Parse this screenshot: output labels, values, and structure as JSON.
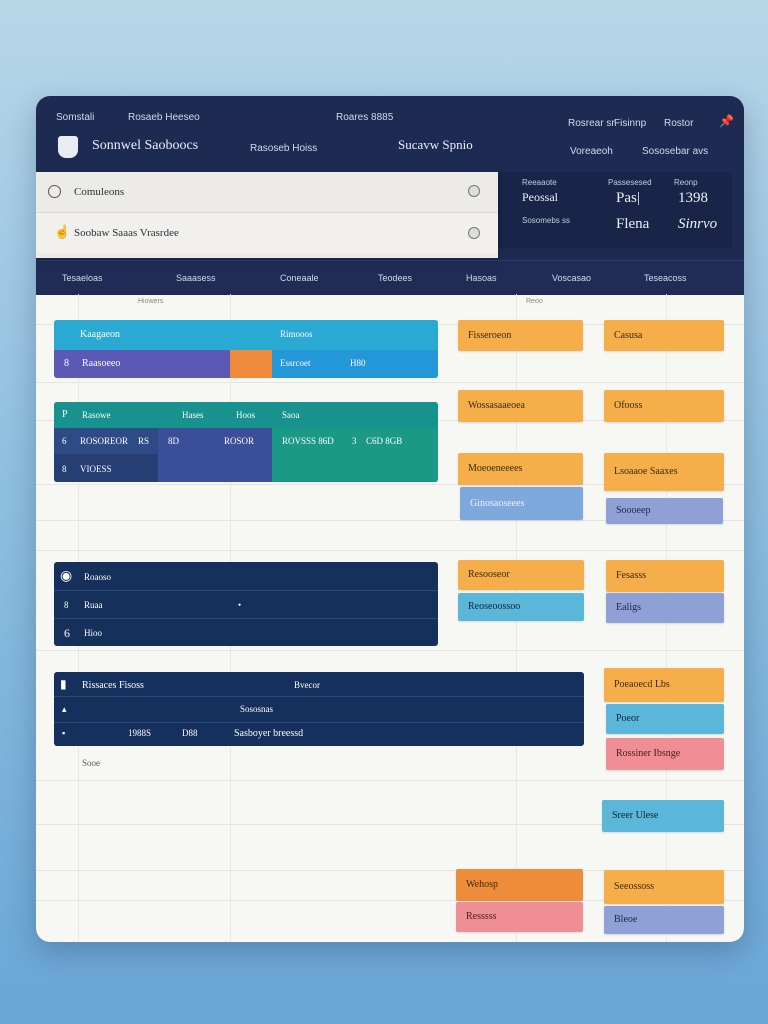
{
  "header": {
    "nav_left": [
      "Somstali",
      "Rosaeb Heeseo"
    ],
    "nav_center": "Roares 8885",
    "nav_right": [
      "Rosrear sr",
      "Fisinnp",
      "Rostor"
    ],
    "app_title": "Sonnwel Saoboocs",
    "app_subtitle": "Rasoseb Hoiss",
    "center_title": "Sucavw Spnio",
    "right_sub": [
      "Voreaeoh",
      "Sososebar avs"
    ]
  },
  "search": {
    "row1": "Comuleons",
    "row2": "Soobaw Saaas Vrasrdee"
  },
  "stats": {
    "labels": [
      "Reeaaote",
      "Passesesed",
      "Reonp"
    ],
    "row1": [
      "Peossal",
      "Pas|",
      "1398"
    ],
    "row2": [
      "Sosomebs ss",
      "Flena",
      "Sinrvo"
    ]
  },
  "tabs": [
    "Tesaeloas",
    "Saaasess",
    "Coneaale",
    "Teodees",
    "Hasoas",
    "Voscasao",
    "Teseacoss"
  ],
  "subheaders": [
    "Hiowers",
    "Reoo"
  ],
  "blocks": {
    "b1": {
      "title": "Kaagaeon",
      "title2": "Rimooos",
      "row": [
        "8",
        "Raasoeeo",
        "Essrcoet",
        "H80"
      ]
    },
    "b2": {
      "h": [
        "P",
        "Rasowe",
        "Hases",
        "Hoos",
        "Saoa"
      ],
      "r1": [
        "6",
        "ROSOREOR",
        "RS",
        "8D",
        "ROSOR",
        "ROVSSS 86D",
        "3",
        "C6D 8GB"
      ],
      "r2": [
        "8",
        "VIOESS"
      ]
    },
    "b3": {
      "r": [
        "Roaoso",
        "Ruaa",
        "Hioo"
      ],
      "icons": [
        "8",
        "6"
      ]
    },
    "b4": {
      "h": [
        "Rissaces Fisoss",
        "Bvecor"
      ],
      "sub": "Sososnas",
      "r": [
        "1988S",
        "D88",
        "Sasboyer breessd"
      ],
      "below": "Sooe"
    }
  },
  "tags": [
    "Fisseroeon",
    "Casusa",
    "Wossasaaeoea",
    "Ofooss",
    "Moeoeneeees",
    "Lsoaaoe Saaxes",
    "Ginosaoseees",
    "Soooeep",
    "Resooseor",
    "Fesasss",
    "Reoseoossoo",
    "Ealigs",
    "Poeaoecd Lbs",
    "Poeor",
    "Rossiner Ibsnge",
    "Sreer Ulese",
    "Wehosp",
    "Seeossoss",
    "Resssss",
    "Bleoe"
  ]
}
